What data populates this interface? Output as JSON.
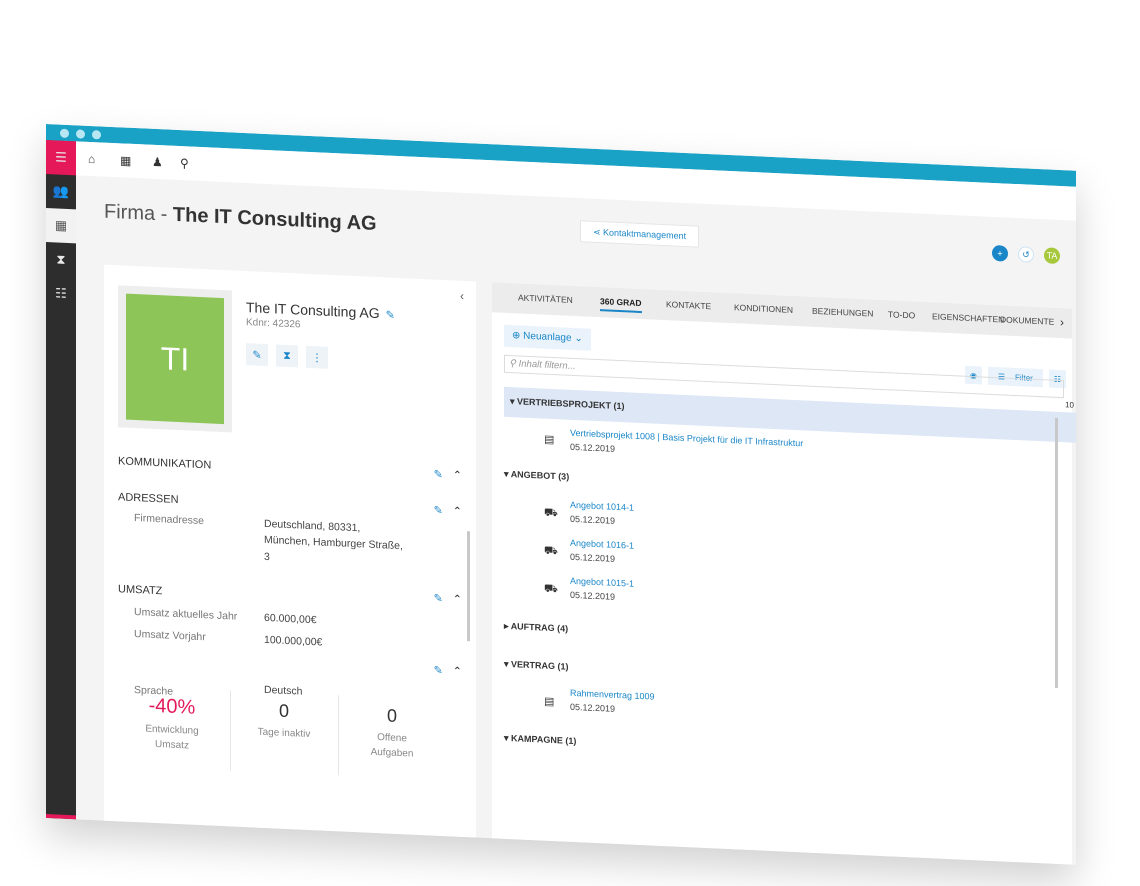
{
  "header": {
    "page_title_prefix": "Firma - ",
    "page_title_name": "The IT Consulting AG",
    "module_button": "Kontaktmanagement",
    "user_initials": "TA"
  },
  "company": {
    "initials": "TI",
    "name": "The IT Consulting AG",
    "kdnr": "Kdnr: 42326"
  },
  "sections": {
    "kommunikation": "KOMMUNIKATION",
    "adressen": "ADRESSEN",
    "firmenadresse_label": "Firmenadresse",
    "firmenadresse_line1": "Deutschland, 80331,",
    "firmenadresse_line2": "München, Hamburger Straße,",
    "firmenadresse_line3": "3",
    "umsatz": "UMSATZ",
    "umsatz_aktuell_label": "Umsatz aktuelles Jahr",
    "umsatz_aktuell_value": "60.000,00€",
    "umsatz_vorjahr_label": "Umsatz Vorjahr",
    "umsatz_vorjahr_value": "100.000,00€",
    "sprache_label": "Sprache",
    "sprache_value": "Deutsch"
  },
  "stats": [
    {
      "value": "-40%",
      "label1": "Entwicklung",
      "label2": "Umsatz"
    },
    {
      "value": "0",
      "label1": "Tage inaktiv",
      "label2": ""
    },
    {
      "value": "0",
      "label1": "Offene",
      "label2": "Aufgaben"
    }
  ],
  "tabs": [
    "AKTIVITÄTEN",
    "360 GRAD",
    "KONTAKTE",
    "KONDITIONEN",
    "BEZIEHUNGEN",
    "TO-DO",
    "EIGENSCHAFTEN",
    "DOKUMENTE"
  ],
  "toolbar": {
    "neuanlage": "Neuanlage",
    "filter_placeholder": "Inhalt filtern...",
    "filter_label": "Filter",
    "count": "10"
  },
  "groups": {
    "vertriebsprojekt": "VERTRIEBSPROJEKT (1)",
    "angebot": "ANGEBOT (3)",
    "auftrag": "AUFTRAG (4)",
    "vertrag": "VERTRAG (1)",
    "kampagne": "KAMPAGNE (1)"
  },
  "entries": {
    "vp1_title": "Vertriebsprojekt 1008 | Basis Projekt für die IT Infrastruktur",
    "vp1_date": "05.12.2019",
    "ang1_title": "Angebot 1014-1",
    "ang1_date": "05.12.2019",
    "ang2_title": "Angebot 1016-1",
    "ang2_date": "05.12.2019",
    "ang3_title": "Angebot 1015-1",
    "ang3_date": "05.12.2019",
    "vt1_title": "Rahmenvertrag 1009",
    "vt1_date": "05.12.2019"
  }
}
